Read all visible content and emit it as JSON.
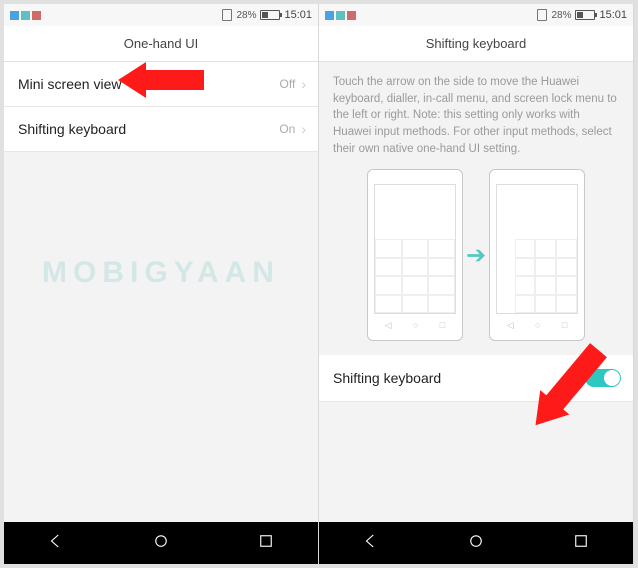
{
  "status": {
    "battery_pct": "28%",
    "time": "15:01"
  },
  "left": {
    "header": "One-hand UI",
    "rows": [
      {
        "label": "Mini screen view",
        "value": "Off"
      },
      {
        "label": "Shifting keyboard",
        "value": "On"
      }
    ]
  },
  "right": {
    "header": "Shifting keyboard",
    "desc": "Touch the arrow on the side to move the Huawei keyboard, dialler, in-call menu, and screen lock menu to the left or right. Note: this setting only works with Huawei input methods. For other input methods, select their own native one-hand UI setting.",
    "toggle_label": "Shifting keyboard",
    "toggle_on": true
  },
  "watermark": "MOBIGYAAN"
}
